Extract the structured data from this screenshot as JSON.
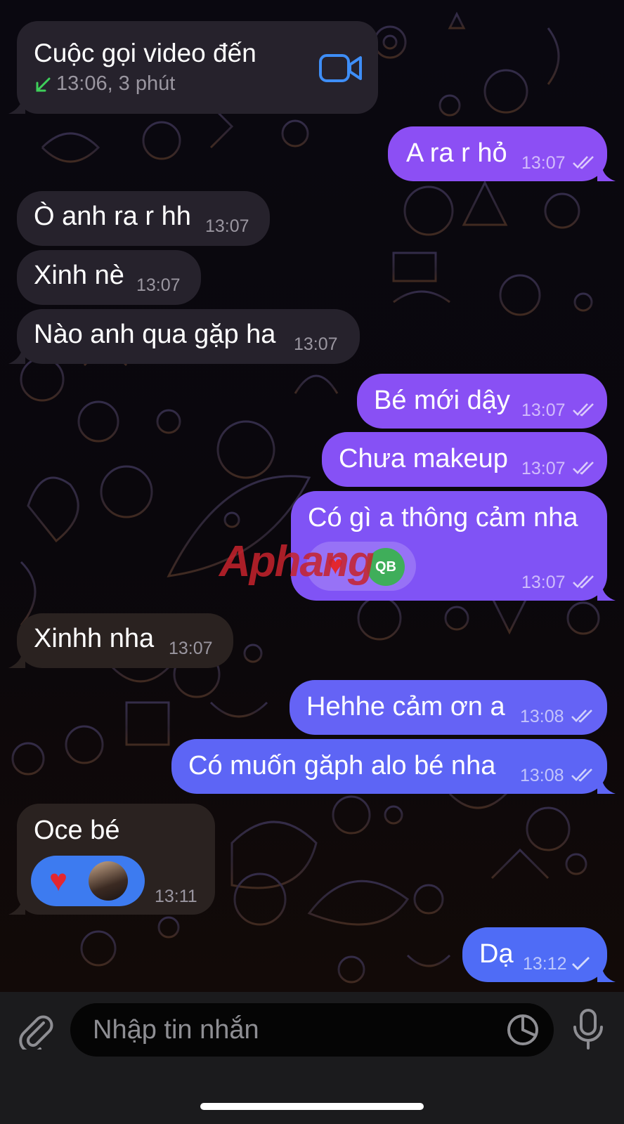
{
  "call": {
    "title": "Cuộc gọi video đến",
    "detail": "13:06, 3 phút",
    "icon": "video-camera-icon",
    "direction_icon": "incoming-arrow-icon"
  },
  "messages": [
    {
      "text": "A ra r hỏ",
      "time": "13:07",
      "dir": "out",
      "status": "read"
    },
    {
      "text": "Ò anh ra r hh",
      "time": "13:07",
      "dir": "in"
    },
    {
      "text": "Xinh nè",
      "time": "13:07",
      "dir": "in"
    },
    {
      "text": "Nào anh qua gặp ha",
      "time": "13:07",
      "dir": "in"
    },
    {
      "text": "Bé mới dậy",
      "time": "13:07",
      "dir": "out",
      "status": "read"
    },
    {
      "text": "Chưa makeup",
      "time": "13:07",
      "dir": "out",
      "status": "read"
    },
    {
      "text": "Có gì a thông cảm nha",
      "time": "13:07",
      "dir": "out",
      "status": "read",
      "reaction": {
        "emoji": "❤️",
        "avatar_initials": "QB"
      }
    },
    {
      "text": "Xinhh nha",
      "time": "13:07",
      "dir": "in"
    },
    {
      "text": "Hehhe cảm ơn a",
      "time": "13:08",
      "dir": "out",
      "status": "read"
    },
    {
      "text": "Có muốn găph alo bé nha",
      "time": "13:08",
      "dir": "out",
      "status": "read"
    },
    {
      "text": "Oce bé",
      "time": "13:11",
      "dir": "in",
      "reaction": {
        "emoji": "❤️",
        "avatar": "profile-photo"
      }
    },
    {
      "text": "Dạ",
      "time": "13:12",
      "dir": "out",
      "status": "sent"
    }
  ],
  "watermark": "Aphang",
  "composer": {
    "placeholder": "Nhập tin nhắn",
    "attach_icon": "paperclip-icon",
    "sticker_icon": "sticker-icon",
    "mic_icon": "microphone-icon"
  },
  "colors": {
    "out_top": "#9a52f2",
    "out_bottom": "#4f6cf6",
    "incoming": "#26222c",
    "reaction_bg": "#3d7bf0",
    "call_icon": "#3e8ef7",
    "incoming_arrow": "#3ecf5a"
  }
}
